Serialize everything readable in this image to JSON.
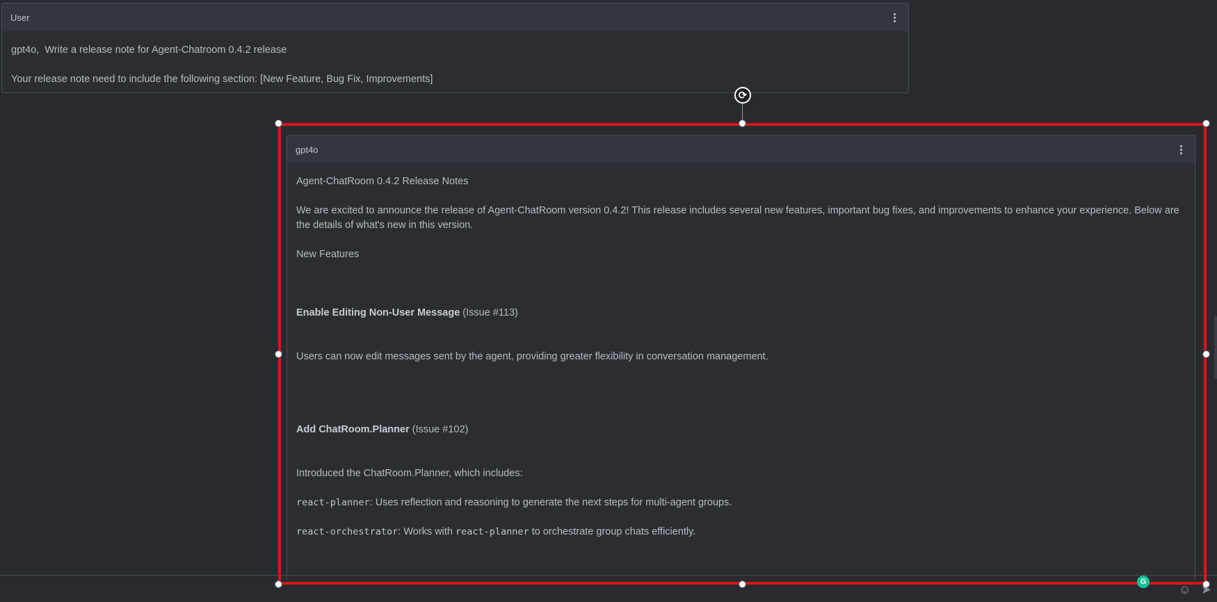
{
  "user_card": {
    "title": "User",
    "lines": [
      "gpt4o,  Write a release note for Agent-Chatroom 0.4.2 release",
      "Your release note need to include the following section: [New Feature, Bug Fix, Improvements]"
    ]
  },
  "agent_card": {
    "title": "gpt4o",
    "heading": "Agent-ChatRoom 0.4.2 Release Notes",
    "intro": "We are excited to announce the release of Agent-ChatRoom version 0.4.2! This release includes several new features, important bug fixes, and improvements to enhance your experience. Below are the details of what's new in this version.",
    "section_new_features": "New Features",
    "feature1_title": "Enable Editing Non-User Message",
    "feature1_issue": " (Issue #113)",
    "feature1_desc": "Users can now edit messages sent by the agent, providing greater flexibility in conversation management.",
    "feature2_title": "Add ChatRoom.Planner",
    "feature2_issue": " (Issue #102)",
    "feature2_desc": "Introduced the ChatRoom.Planner, which includes:",
    "item1_code": "react-planner",
    "item1_text": ": Uses reflection and reasoning to generate the next steps for multi-agent groups.",
    "item2_code": "react-orchestrator",
    "item2_text_a": ": Works with ",
    "item2_code_b": "react-planner",
    "item2_text_b": " to orchestrate group chats efficiently."
  },
  "icons": {
    "menu": "more-vertical-icon",
    "rotate": "rotate-icon",
    "emoji": "emoji-icon",
    "send": "send-icon",
    "grammarly": "grammarly-icon"
  },
  "colors": {
    "background": "#282a2f",
    "selection": "#d9161c",
    "header": "#34363d"
  }
}
